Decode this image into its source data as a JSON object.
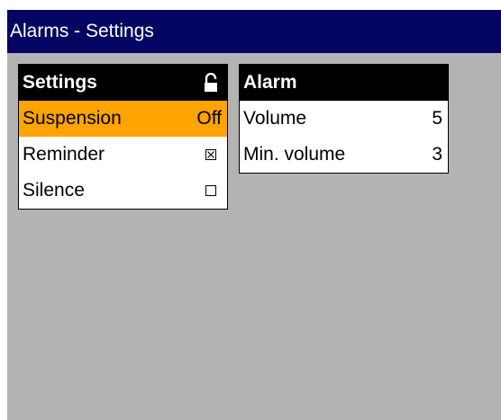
{
  "window": {
    "title": "Alarms - Settings"
  },
  "settings_panel": {
    "header": "Settings",
    "header_icon": "lock-open-icon",
    "rows": [
      {
        "label": "Suspension",
        "value": "Off",
        "selected": true
      },
      {
        "label": "Reminder",
        "state": "checked",
        "icon": "checkbox-checked-icon"
      },
      {
        "label": "Silence",
        "state": "unchecked",
        "icon": "checkbox-unchecked-icon"
      }
    ]
  },
  "alarm_panel": {
    "header": "Alarm",
    "rows": [
      {
        "label": "Volume",
        "value": "5"
      },
      {
        "label": "Min. volume",
        "value": "3"
      }
    ]
  },
  "colors": {
    "titlebar": "#050563",
    "background": "#b3b3b3",
    "selection": "#ffa400",
    "panel_header": "#000000"
  }
}
